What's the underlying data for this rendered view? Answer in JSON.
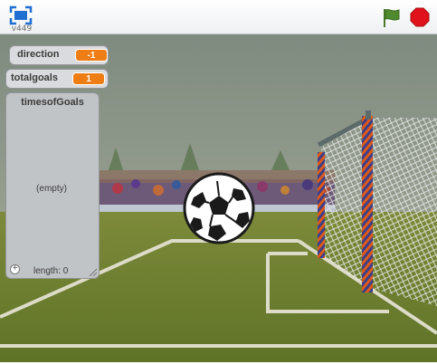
{
  "app": {
    "version": "v449",
    "icons": {
      "fullscreen": "fullscreen-icon",
      "green_flag": "green-flag-icon",
      "stop": "stop-sign-icon"
    },
    "colors": {
      "flag": "#4a7a2a",
      "stop": "#e0121b",
      "fullscreen": "#1e6fd0",
      "monitor_value": "#ee7d16"
    }
  },
  "monitors": {
    "direction": {
      "label": "direction",
      "value": "-1"
    },
    "totalgoals": {
      "label": "totalgoals",
      "value": "1"
    }
  },
  "list": {
    "title": "timesofGoals",
    "empty_text": "(empty)",
    "add_symbol": "+",
    "length_text": "length: 0"
  }
}
